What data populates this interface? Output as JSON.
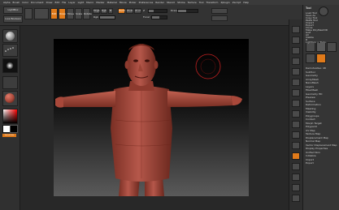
{
  "menubar": {
    "items": [
      "Alpha",
      "Brush",
      "Color",
      "Document",
      "Draw",
      "Edit",
      "File",
      "Layer",
      "Light",
      "Macro",
      "Marker",
      "Material",
      "Movie",
      "Picker",
      "Preferences",
      "Render",
      "Stencil",
      "Stroke",
      "Texture",
      "Tool",
      "Transform",
      "Zplugin",
      "Zscript",
      "Help"
    ]
  },
  "toolbar": {
    "lightbox_label": "LightBox",
    "livebool_label": "Live Boolean",
    "edit_label": "Edit",
    "draw_label": "Draw",
    "move_label": "Move",
    "scale_label": "Scale",
    "rotate_label": "Rotate",
    "mrgb_label": "Mrgb",
    "rgb_label": "Rgb",
    "m_label": "M",
    "zadd_label": "Zadd",
    "zsub_label": "Zsub",
    "zcut_label": "Zcut",
    "focal_label": "Focal",
    "draw_size_label": "Draw",
    "z_intensity_label": "Z",
    "rgb_intensity_label": "Rgb"
  },
  "left_shelf": {
    "brush_icon": "clay-brush-icon",
    "stroke_icon": "dots-stroke-icon",
    "alpha_icon": "alpha-icon",
    "material_icon": "material-sphere-icon",
    "color_picker_icon": "color-picker-icon",
    "switch_color_label": "SwitchColor"
  },
  "viewport": {
    "model": "red-clay-character-t-pose",
    "brush_cursor": "brush-cursor-circle"
  },
  "right_shelf": {
    "buttons": [
      "bpr-icon",
      "spix-icon",
      "scroll-icon",
      "zoom-icon",
      "actual-icon",
      "aahalf-icon",
      "persp-icon",
      "floor-icon",
      "local-icon",
      "xyz-icon",
      "frame-icon",
      "move-icon",
      "scale-icon",
      "rotate-icon",
      "polyf-icon",
      "transp-icon",
      "solo-icon"
    ]
  },
  "tray": {
    "header": "Tool",
    "items": [
      "Load Tool",
      "Save As",
      "Copy Tool",
      "Paste Tool",
      "Import",
      "Export",
      "Clone",
      "Make PolyMesh3D",
      "GoZ",
      "All",
      "Visible",
      "R",
      "Lightbox > Tools",
      "DemoSoldier. 48",
      "SubTool",
      "Geometry",
      "ArrayMesh",
      "NanoMesh",
      "Layers",
      "FiberMesh",
      "Geometry HD",
      "Preview",
      "Surface",
      "Deformation",
      "Masking",
      "Visibility",
      "Polygroups",
      "Contact",
      "Morph Target",
      "Polypaint",
      "UV Map",
      "Texture Map",
      "Displacement Map",
      "Normal Map",
      "Vector Displacement Map",
      "Display Properties",
      "Unified Skin",
      "Initialize",
      "Import",
      "Export"
    ]
  },
  "colors": {
    "accent": "#e07a1a",
    "clay": "#a8483a",
    "bg": "#2a2a2a"
  }
}
